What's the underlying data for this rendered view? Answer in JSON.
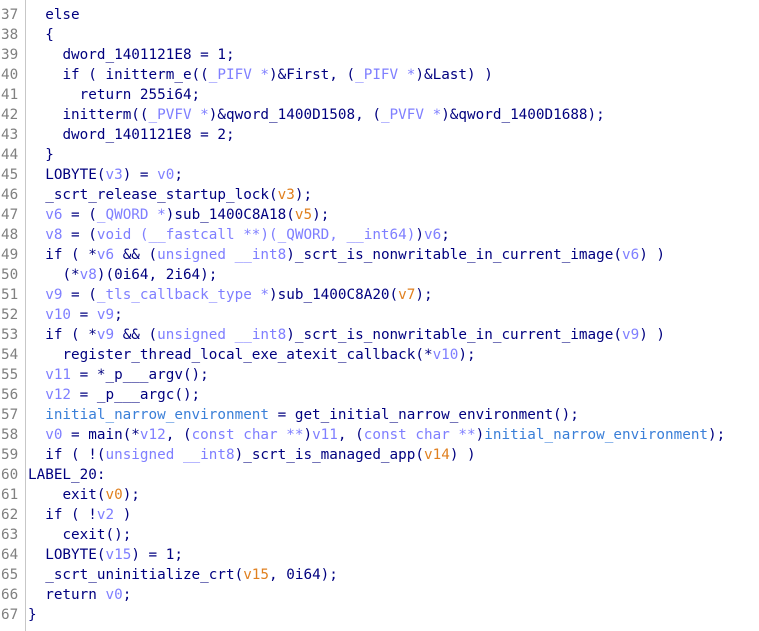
{
  "colors": {
    "plain": "#00007f",
    "var": "#7f7fff",
    "arg": "#e08020",
    "global": "#3a7fd8",
    "line_number": "#808080",
    "background": "#ffffff"
  },
  "lines": [
    {
      "n": "37",
      "indent": 2,
      "tokens": [
        [
          "plain",
          "else"
        ]
      ]
    },
    {
      "n": "38",
      "indent": 2,
      "tokens": [
        [
          "plain",
          "{"
        ]
      ]
    },
    {
      "n": "39",
      "indent": 4,
      "tokens": [
        [
          "plain",
          "dword_1401121E8 = 1;"
        ]
      ]
    },
    {
      "n": "40",
      "indent": 4,
      "tokens": [
        [
          "plain",
          "if ( initterm_e(("
        ],
        [
          "var",
          "_PIFV *"
        ],
        [
          "plain",
          ")&First, ("
        ],
        [
          "var",
          "_PIFV *"
        ],
        [
          "plain",
          ")&Last) )"
        ]
      ]
    },
    {
      "n": "41",
      "indent": 6,
      "tokens": [
        [
          "plain",
          "return 255i64;"
        ]
      ]
    },
    {
      "n": "42",
      "indent": 4,
      "tokens": [
        [
          "plain",
          "initterm(("
        ],
        [
          "var",
          "_PVFV *"
        ],
        [
          "plain",
          ")&qword_1400D1508, ("
        ],
        [
          "var",
          "_PVFV *"
        ],
        [
          "plain",
          ")&qword_1400D1688);"
        ]
      ]
    },
    {
      "n": "43",
      "indent": 4,
      "tokens": [
        [
          "plain",
          "dword_1401121E8 = 2;"
        ]
      ]
    },
    {
      "n": "44",
      "indent": 2,
      "tokens": [
        [
          "plain",
          "}"
        ]
      ]
    },
    {
      "n": "45",
      "indent": 2,
      "tokens": [
        [
          "plain",
          "LOBYTE("
        ],
        [
          "var",
          "v3"
        ],
        [
          "plain",
          ") = "
        ],
        [
          "var",
          "v0"
        ],
        [
          "plain",
          ";"
        ]
      ]
    },
    {
      "n": "46",
      "indent": 2,
      "tokens": [
        [
          "plain",
          "_scrt_release_startup_lock("
        ],
        [
          "arg",
          "v3"
        ],
        [
          "plain",
          ");"
        ]
      ]
    },
    {
      "n": "47",
      "indent": 2,
      "tokens": [
        [
          "var",
          "v6"
        ],
        [
          "plain",
          " = ("
        ],
        [
          "var",
          "_QWORD *"
        ],
        [
          "plain",
          ")sub_1400C8A18("
        ],
        [
          "arg",
          "v5"
        ],
        [
          "plain",
          ");"
        ]
      ]
    },
    {
      "n": "48",
      "indent": 2,
      "tokens": [
        [
          "var",
          "v8"
        ],
        [
          "plain",
          " = ("
        ],
        [
          "var",
          "void (__fastcall **)(_QWORD, __int64)"
        ],
        [
          "plain",
          ")"
        ],
        [
          "var",
          "v6"
        ],
        [
          "plain",
          ";"
        ]
      ]
    },
    {
      "n": "49",
      "indent": 2,
      "tokens": [
        [
          "plain",
          "if ( *"
        ],
        [
          "var",
          "v6"
        ],
        [
          "plain",
          " && ("
        ],
        [
          "var",
          "unsigned __int8"
        ],
        [
          "plain",
          ")_scrt_is_nonwritable_in_current_image("
        ],
        [
          "var",
          "v6"
        ],
        [
          "plain",
          ") )"
        ]
      ]
    },
    {
      "n": "50",
      "indent": 4,
      "tokens": [
        [
          "plain",
          "(*"
        ],
        [
          "var",
          "v8"
        ],
        [
          "plain",
          ")(0i64, 2i64);"
        ]
      ]
    },
    {
      "n": "51",
      "indent": 2,
      "tokens": [
        [
          "var",
          "v9"
        ],
        [
          "plain",
          " = ("
        ],
        [
          "var",
          "_tls_callback_type *"
        ],
        [
          "plain",
          ")sub_1400C8A20("
        ],
        [
          "arg",
          "v7"
        ],
        [
          "plain",
          ");"
        ]
      ]
    },
    {
      "n": "52",
      "indent": 2,
      "tokens": [
        [
          "var",
          "v10"
        ],
        [
          "plain",
          " = "
        ],
        [
          "var",
          "v9"
        ],
        [
          "plain",
          ";"
        ]
      ]
    },
    {
      "n": "53",
      "indent": 2,
      "tokens": [
        [
          "plain",
          "if ( *"
        ],
        [
          "var",
          "v9"
        ],
        [
          "plain",
          " && ("
        ],
        [
          "var",
          "unsigned __int8"
        ],
        [
          "plain",
          ")_scrt_is_nonwritable_in_current_image("
        ],
        [
          "var",
          "v9"
        ],
        [
          "plain",
          ") )"
        ]
      ]
    },
    {
      "n": "54",
      "indent": 4,
      "tokens": [
        [
          "plain",
          "register_thread_local_exe_atexit_callback(*"
        ],
        [
          "var",
          "v10"
        ],
        [
          "plain",
          ");"
        ]
      ]
    },
    {
      "n": "55",
      "indent": 2,
      "tokens": [
        [
          "var",
          "v11"
        ],
        [
          "plain",
          " = *_p___argv();"
        ]
      ]
    },
    {
      "n": "56",
      "indent": 2,
      "tokens": [
        [
          "var",
          "v12"
        ],
        [
          "plain",
          " = _p___argc();"
        ]
      ]
    },
    {
      "n": "57",
      "indent": 2,
      "tokens": [
        [
          "glob",
          "initial_narrow_environment"
        ],
        [
          "plain",
          " = get_initial_narrow_environment();"
        ]
      ]
    },
    {
      "n": "58",
      "indent": 2,
      "tokens": [
        [
          "var",
          "v0"
        ],
        [
          "plain",
          " = main(*"
        ],
        [
          "var",
          "v12"
        ],
        [
          "plain",
          ", ("
        ],
        [
          "var",
          "const char **"
        ],
        [
          "plain",
          ")"
        ],
        [
          "var",
          "v11"
        ],
        [
          "plain",
          ", ("
        ],
        [
          "var",
          "const char **"
        ],
        [
          "plain",
          ")"
        ],
        [
          "glob",
          "initial_narrow_environment"
        ],
        [
          "plain",
          ");"
        ]
      ]
    },
    {
      "n": "59",
      "indent": 2,
      "tokens": [
        [
          "plain",
          "if ( !("
        ],
        [
          "var",
          "unsigned __int8"
        ],
        [
          "plain",
          ")_scrt_is_managed_app("
        ],
        [
          "arg",
          "v14"
        ],
        [
          "plain",
          ") )"
        ]
      ]
    },
    {
      "n": "60",
      "indent": 0,
      "tokens": [
        [
          "plain",
          "LABEL_20:"
        ]
      ]
    },
    {
      "n": "61",
      "indent": 4,
      "tokens": [
        [
          "plain",
          "exit("
        ],
        [
          "arg",
          "v0"
        ],
        [
          "plain",
          ");"
        ]
      ]
    },
    {
      "n": "62",
      "indent": 2,
      "tokens": [
        [
          "plain",
          "if ( !"
        ],
        [
          "var",
          "v2"
        ],
        [
          "plain",
          " )"
        ]
      ]
    },
    {
      "n": "63",
      "indent": 4,
      "tokens": [
        [
          "plain",
          "cexit();"
        ]
      ]
    },
    {
      "n": "64",
      "indent": 2,
      "tokens": [
        [
          "plain",
          "LOBYTE("
        ],
        [
          "var",
          "v15"
        ],
        [
          "plain",
          ") = 1;"
        ]
      ]
    },
    {
      "n": "65",
      "indent": 2,
      "tokens": [
        [
          "plain",
          "_scrt_uninitialize_crt("
        ],
        [
          "arg",
          "v15"
        ],
        [
          "plain",
          ", 0i64);"
        ]
      ]
    },
    {
      "n": "66",
      "indent": 2,
      "tokens": [
        [
          "plain",
          "return "
        ],
        [
          "var",
          "v0"
        ],
        [
          "plain",
          ";"
        ]
      ]
    },
    {
      "n": "67",
      "indent": 0,
      "tokens": [
        [
          "plain",
          "}"
        ]
      ]
    }
  ]
}
